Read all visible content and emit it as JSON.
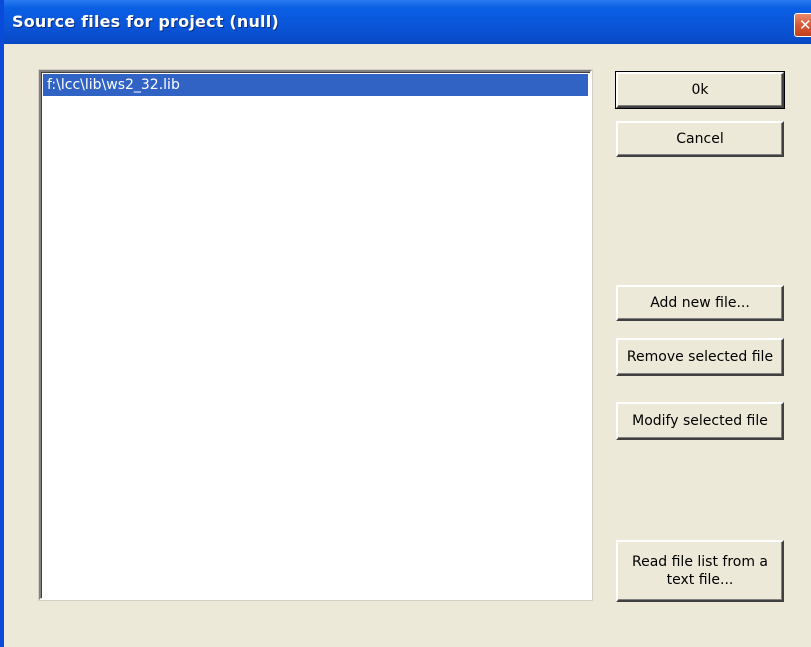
{
  "window": {
    "title": "Source files for project (null)",
    "close_icon": "close-icon"
  },
  "file_list": {
    "items": [
      "f:\\lcc\\lib\\ws2_32.lib"
    ],
    "selected_index": 0
  },
  "buttons": {
    "ok": "0k",
    "cancel": "Cancel",
    "add_new_file": "Add new file...",
    "remove_selected_file": "Remove selected file",
    "modify_selected_file": "Modify selected file",
    "read_file_list": "Read file list from a text file..."
  },
  "colors": {
    "titlebar": "#0a55d8",
    "selection": "#3163c5",
    "dialog_bg": "#ece9d8"
  }
}
